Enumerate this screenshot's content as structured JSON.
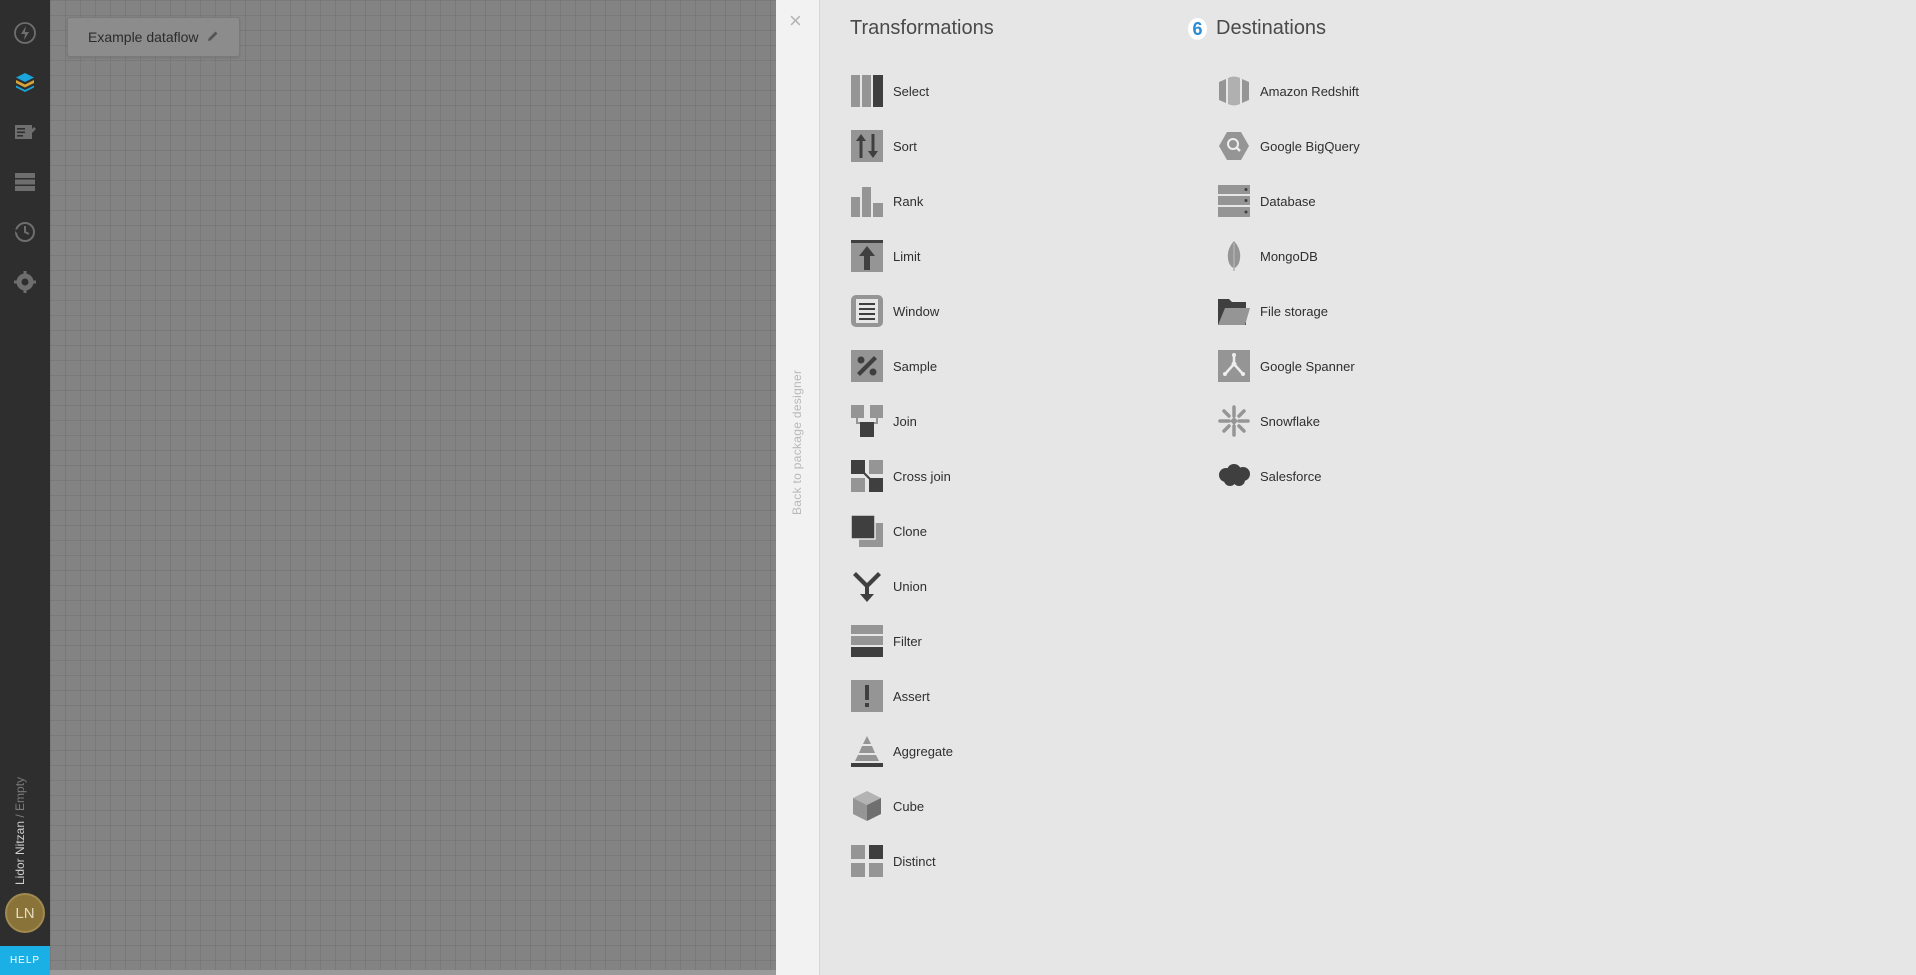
{
  "sidebar": {
    "icons": [
      "lightning-icon",
      "packages-icon",
      "jobs-icon",
      "connections-icon",
      "schedules-icon",
      "settings-icon"
    ],
    "user": {
      "name": "Lidor Nitzan",
      "workspace": "Empty",
      "initials": "LN",
      "avatar_color": "#8a7338"
    },
    "help_label": "HELP",
    "help_color": "#1ab0e6"
  },
  "canvas": {
    "dataflow_name": "Example dataflow"
  },
  "panel": {
    "close_glyph": "×",
    "back_label": "Back to package designer",
    "transformations_title": "Transformations",
    "step_number": "6",
    "destinations_title": "Destinations",
    "transformations": [
      {
        "label": "Select",
        "icon": "select-icon"
      },
      {
        "label": "Sort",
        "icon": "sort-icon"
      },
      {
        "label": "Rank",
        "icon": "rank-icon"
      },
      {
        "label": "Limit",
        "icon": "limit-icon"
      },
      {
        "label": "Window",
        "icon": "window-icon"
      },
      {
        "label": "Sample",
        "icon": "sample-icon"
      },
      {
        "label": "Join",
        "icon": "join-icon"
      },
      {
        "label": "Cross join",
        "icon": "cross-join-icon"
      },
      {
        "label": "Clone",
        "icon": "clone-icon"
      },
      {
        "label": "Union",
        "icon": "union-icon"
      },
      {
        "label": "Filter",
        "icon": "filter-icon"
      },
      {
        "label": "Assert",
        "icon": "assert-icon"
      },
      {
        "label": "Aggregate",
        "icon": "aggregate-icon"
      },
      {
        "label": "Cube",
        "icon": "cube-icon"
      },
      {
        "label": "Distinct",
        "icon": "distinct-icon"
      }
    ],
    "destinations": [
      {
        "label": "Amazon Redshift",
        "icon": "redshift-icon"
      },
      {
        "label": "Google BigQuery",
        "icon": "bigquery-icon"
      },
      {
        "label": "Database",
        "icon": "database-icon"
      },
      {
        "label": "MongoDB",
        "icon": "mongodb-icon"
      },
      {
        "label": "File storage",
        "icon": "file-storage-icon"
      },
      {
        "label": "Google Spanner",
        "icon": "spanner-icon"
      },
      {
        "label": "Snowflake",
        "icon": "snowflake-icon"
      },
      {
        "label": "Salesforce",
        "icon": "salesforce-icon"
      }
    ]
  },
  "colors": {
    "accent": "#2a8bd6",
    "nav_background": "#2e2e2e",
    "canvas_background": "#838383",
    "panel_background": "#e6e6e6",
    "icon_dark": "#3f3f3f",
    "icon_light": "#959595"
  }
}
